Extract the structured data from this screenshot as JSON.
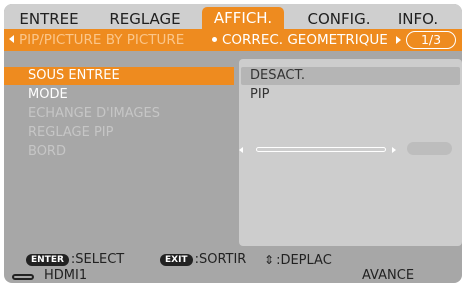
{
  "tabs": [
    {
      "label": "ENTREE",
      "active": false
    },
    {
      "label": "REGLAGE",
      "active": false
    },
    {
      "label": "AFFICH.",
      "active": true
    },
    {
      "label": "CONFIG.",
      "active": false
    },
    {
      "label": "INFO.",
      "active": false
    }
  ],
  "subnav": {
    "items": [
      "PIP/PICTURE BY PICTURE",
      "CORREC. GEOMETRIQUE"
    ],
    "active_index": 0,
    "pager": "1/3"
  },
  "menu": {
    "items": [
      {
        "label": "SOUS ENTREE",
        "state": "selected"
      },
      {
        "label": "MODE",
        "state": "normal"
      },
      {
        "label": "ECHANGE D'IMAGES",
        "state": "disabled"
      },
      {
        "label": "REGLAGE PIP",
        "state": "disabled"
      },
      {
        "label": "BORD",
        "state": "disabled"
      }
    ]
  },
  "values": {
    "sous_entree": "DESACT.",
    "mode": "PIP"
  },
  "footer": {
    "enter_key": "ENTER",
    "enter_action": ":SELECT",
    "exit_key": "EXIT",
    "exit_action": ":SORTIR",
    "move_action": ":DEPLAC",
    "input_source": "HDMI1",
    "mode_level": "AVANCE"
  },
  "colors": {
    "accent": "#ee8b1f",
    "panel": "#a7a7a7",
    "tabbar": "#cfcfcf",
    "value_pane": "#cdcdcd"
  }
}
